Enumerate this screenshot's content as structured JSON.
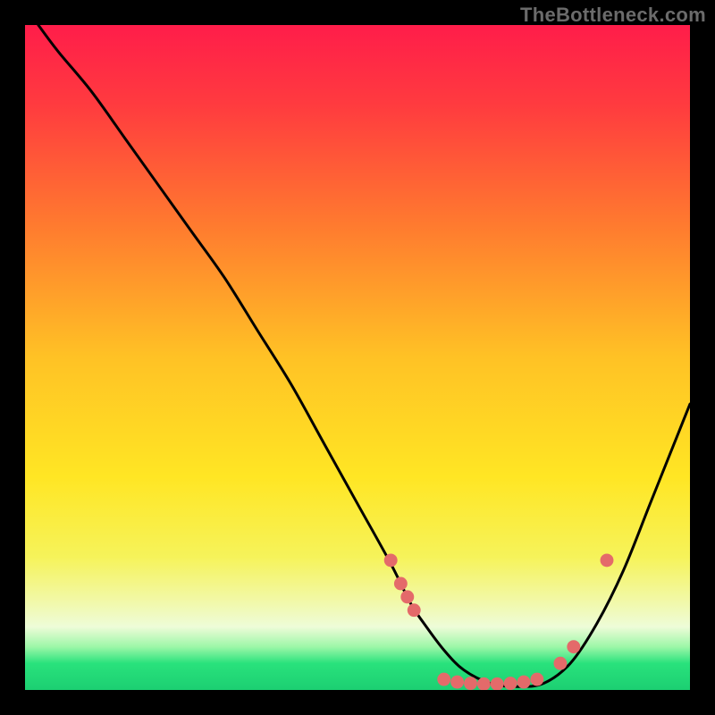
{
  "watermark": "TheBottleneck.com",
  "chart_data": {
    "type": "line",
    "title": "",
    "xlabel": "",
    "ylabel": "",
    "xlim": [
      0,
      100
    ],
    "ylim": [
      0,
      100
    ],
    "grid": false,
    "legend": false,
    "gradient_stops": [
      {
        "offset": 0.0,
        "color": "#ff1d4a"
      },
      {
        "offset": 0.12,
        "color": "#ff3b3f"
      },
      {
        "offset": 0.3,
        "color": "#ff7a2f"
      },
      {
        "offset": 0.5,
        "color": "#ffc225"
      },
      {
        "offset": 0.68,
        "color": "#ffe624"
      },
      {
        "offset": 0.8,
        "color": "#f6f35a"
      },
      {
        "offset": 0.86,
        "color": "#f2f8a0"
      },
      {
        "offset": 0.905,
        "color": "#eefcd8"
      },
      {
        "offset": 0.935,
        "color": "#9df7a8"
      },
      {
        "offset": 0.96,
        "color": "#29e27c"
      },
      {
        "offset": 1.0,
        "color": "#1ccf72"
      }
    ],
    "note": "x/y in 0–100 plot space; y=0 is bottom (good), y=100 is top (bad). Values eyeballed from pixels.",
    "series": [
      {
        "name": "bottleneck-curve",
        "color": "#000000",
        "x": [
          2,
          5,
          10,
          15,
          20,
          25,
          30,
          35,
          40,
          45,
          50,
          55,
          58,
          60,
          63,
          66,
          70,
          74,
          78,
          82,
          86,
          90,
          94,
          98,
          100
        ],
        "y": [
          100,
          96,
          90,
          83,
          76,
          69,
          62,
          54,
          46,
          37,
          28,
          19,
          13,
          10,
          6,
          3,
          1,
          0.5,
          1,
          4,
          10,
          18,
          28,
          38,
          43
        ]
      }
    ],
    "highlight_points": {
      "name": "markers",
      "color": "#e46a6a",
      "radius_frac": 0.01,
      "points": [
        {
          "x": 55.0,
          "y": 19.5
        },
        {
          "x": 56.5,
          "y": 16.0
        },
        {
          "x": 57.5,
          "y": 14.0
        },
        {
          "x": 58.5,
          "y": 12.0
        },
        {
          "x": 63.0,
          "y": 1.6
        },
        {
          "x": 65.0,
          "y": 1.2
        },
        {
          "x": 67.0,
          "y": 1.0
        },
        {
          "x": 69.0,
          "y": 0.9
        },
        {
          "x": 71.0,
          "y": 0.9
        },
        {
          "x": 73.0,
          "y": 1.0
        },
        {
          "x": 75.0,
          "y": 1.2
        },
        {
          "x": 77.0,
          "y": 1.6
        },
        {
          "x": 80.5,
          "y": 4.0
        },
        {
          "x": 82.5,
          "y": 6.5
        },
        {
          "x": 87.5,
          "y": 19.5
        }
      ]
    }
  }
}
